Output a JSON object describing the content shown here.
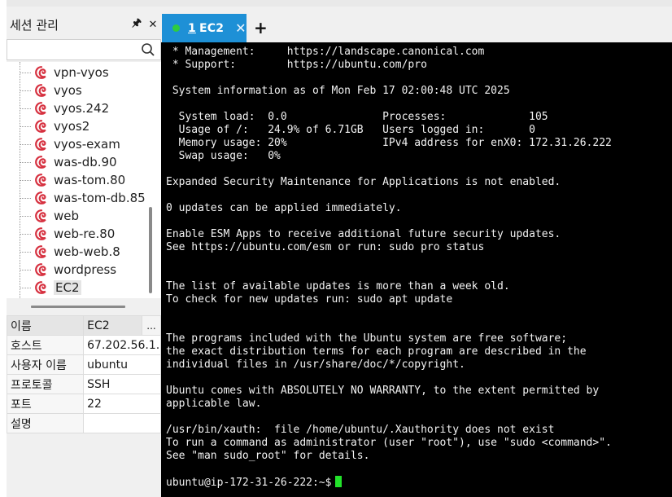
{
  "session_panel": {
    "title": "세션 관리",
    "pin_glyph": "🖈",
    "close_glyph": "✕",
    "search": {
      "value": "",
      "placeholder": ""
    },
    "tree_items": [
      {
        "label": "vpn-vyos",
        "icon": "debian-swirl-icon"
      },
      {
        "label": "vyos",
        "icon": "debian-swirl-icon"
      },
      {
        "label": "vyos.242",
        "icon": "debian-swirl-icon"
      },
      {
        "label": "vyos2",
        "icon": "debian-swirl-icon"
      },
      {
        "label": "vyos-exam",
        "icon": "debian-swirl-icon"
      },
      {
        "label": "was-db.90",
        "icon": "debian-swirl-icon"
      },
      {
        "label": "was-tom.80",
        "icon": "debian-swirl-icon"
      },
      {
        "label": "was-tom-db.85",
        "icon": "debian-swirl-icon"
      },
      {
        "label": "web",
        "icon": "debian-swirl-icon"
      },
      {
        "label": "web-re.80",
        "icon": "debian-swirl-icon"
      },
      {
        "label": "web-web.8",
        "icon": "debian-swirl-icon"
      },
      {
        "label": "wordpress",
        "icon": "debian-swirl-icon"
      },
      {
        "label": "EC2",
        "icon": "debian-swirl-icon",
        "selected": true
      }
    ]
  },
  "properties": {
    "more_label": "...",
    "rows": [
      {
        "key": "이름",
        "value": "EC2"
      },
      {
        "key": "호스트",
        "value": "67.202.56.1..."
      },
      {
        "key": "사용자 이름",
        "value": "ubuntu"
      },
      {
        "key": "프로토콜",
        "value": "SSH"
      },
      {
        "key": "포트",
        "value": "22"
      },
      {
        "key": "설명",
        "value": ""
      }
    ]
  },
  "tabs": [
    {
      "number": "1",
      "label": "EC2",
      "status": "connected",
      "status_color": "#2ecc40",
      "active": true
    }
  ],
  "tab_add_label": "+",
  "terminal": {
    "prompt": "ubuntu@ip-172-31-26-222:~$",
    "cursor_color": "#22e22a",
    "lines": [
      " * Management:     https://landscape.canonical.com",
      " * Support:        https://ubuntu.com/pro",
      "",
      " System information as of Mon Feb 17 02:00:48 UTC 2025",
      "",
      "  System load:  0.0               Processes:             105",
      "  Usage of /:   24.9% of 6.71GB   Users logged in:       0",
      "  Memory usage: 20%               IPv4 address for enX0: 172.31.26.222",
      "  Swap usage:   0%",
      "",
      "Expanded Security Maintenance for Applications is not enabled.",
      "",
      "0 updates can be applied immediately.",
      "",
      "Enable ESM Apps to receive additional future security updates.",
      "See https://ubuntu.com/esm or run: sudo pro status",
      "",
      "",
      "The list of available updates is more than a week old.",
      "To check for new updates run: sudo apt update",
      "",
      "",
      "The programs included with the Ubuntu system are free software;",
      "the exact distribution terms for each program are described in the",
      "individual files in /usr/share/doc/*/copyright.",
      "",
      "Ubuntu comes with ABSOLUTELY NO WARRANTY, to the extent permitted by",
      "applicable law.",
      "",
      "/usr/bin/xauth:  file /home/ubuntu/.Xauthority does not exist",
      "To run a command as administrator (user \"root\"), use \"sudo <command>\".",
      "See \"man sudo_root\" for details.",
      ""
    ]
  }
}
